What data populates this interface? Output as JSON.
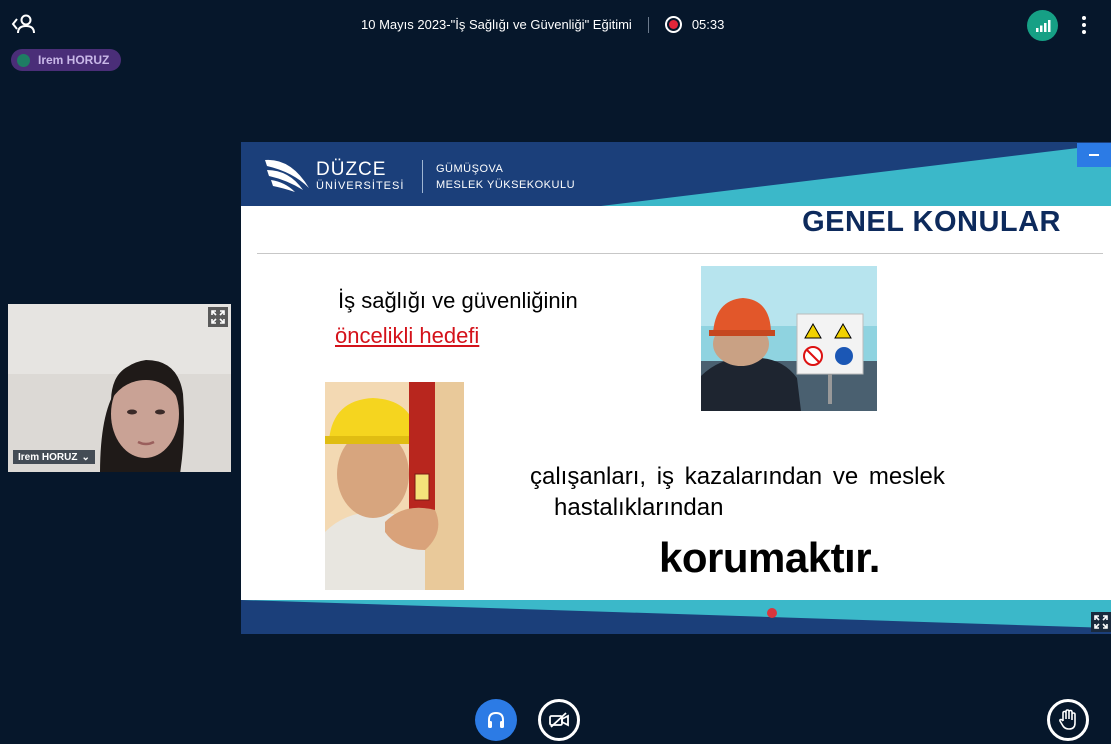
{
  "header": {
    "meeting_title": "10 Mayıs 2023-\"İş Sağlığı ve Güvenliği\" Eğitimi",
    "recording_time": "05:33",
    "icons": {
      "users": "user-list-icon",
      "record": "record-icon",
      "connection": "connection-status-icon",
      "menu": "more-vertical-icon"
    }
  },
  "talking_indicator": {
    "name": "Irem HORUZ"
  },
  "webcam": {
    "user_name": "Irem HORUZ",
    "menu_glyph": "⌄"
  },
  "slide": {
    "university_name": "DÜZCE",
    "university_sub": "ÜNİVERSİTESİ",
    "school_line1": "GÜMÜŞOVA",
    "school_line2": "MESLEK YÜKSEKOKULU",
    "title": "GENEL KONULAR",
    "line1": "İş sağlığı ve güvenliğinin",
    "line2": "öncelikli hedefi",
    "line3": "çalışanları,  iş kazalarından  ve  meslek",
    "line4": "hastalıklarından",
    "line5": "korumaktır."
  },
  "controls": {
    "audio": "headphones-icon",
    "camera": "camera-off-icon",
    "raise_hand": "raise-hand-icon"
  },
  "colors": {
    "background": "#06172b",
    "accent": "#2c7be5",
    "slide_navy": "#1b3f7a",
    "slide_teal": "#3bb8c9",
    "record_red": "#e3263a",
    "connection_green": "#16a085"
  }
}
